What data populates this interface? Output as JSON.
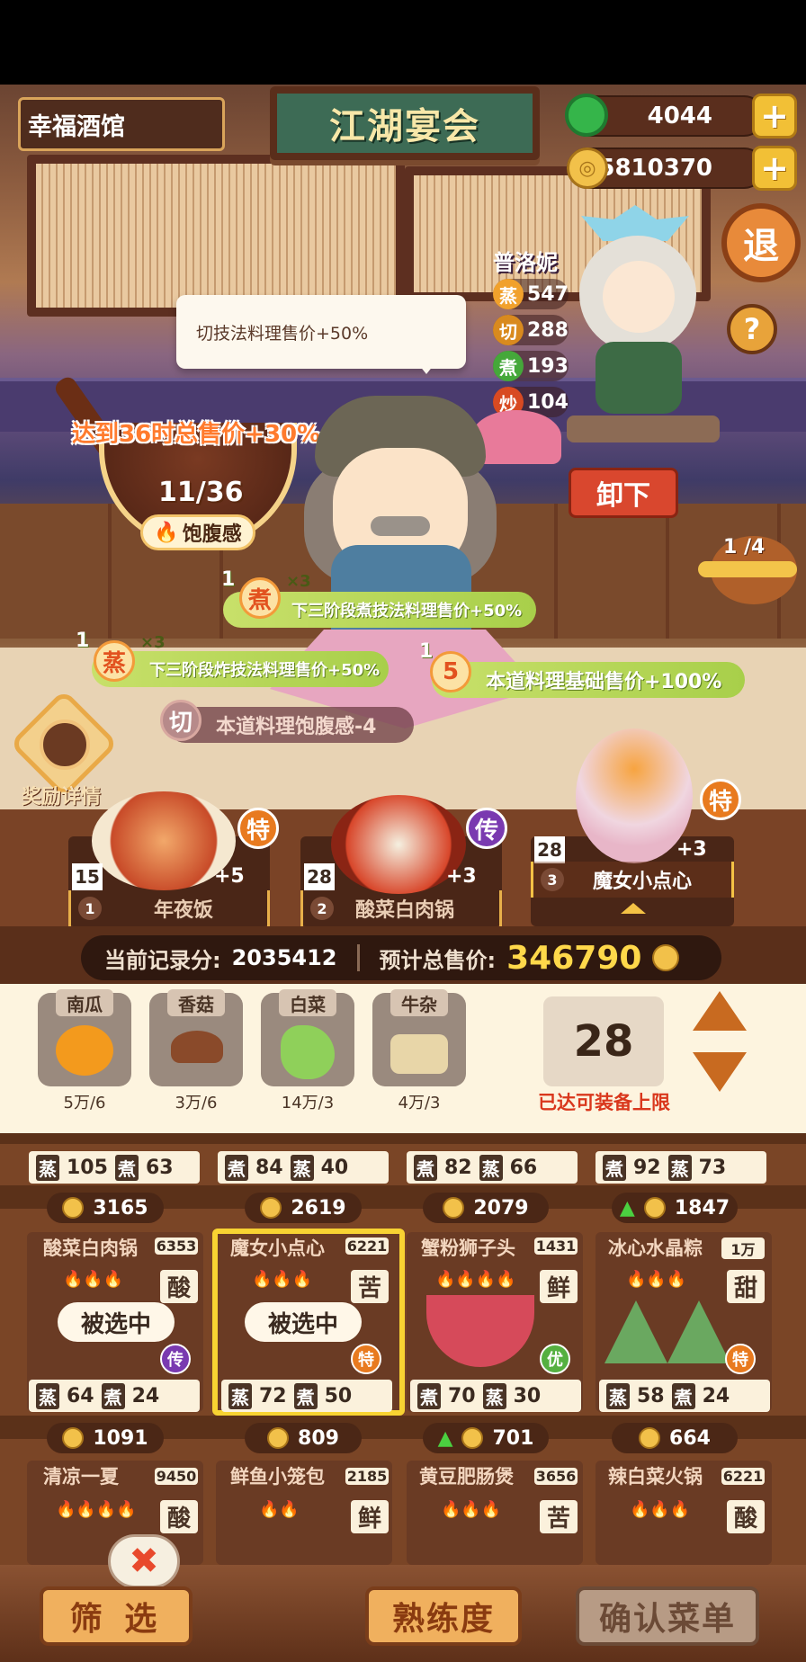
{
  "header": {
    "shop_name": "幸福酒馆",
    "title_sign": "江湖宴会",
    "jade": "4044",
    "coins": "5810370",
    "plus": "+",
    "exit": "退",
    "help": "?"
  },
  "chef": {
    "name": "普洛妮",
    "stats": [
      {
        "key": "蒸",
        "value": "547",
        "color": "#f1a12c"
      },
      {
        "key": "切",
        "value": "288",
        "color": "#d98a1e"
      },
      {
        "key": "煮",
        "value": "193",
        "color": "#45a83a"
      },
      {
        "key": "炒",
        "value": "104",
        "color": "#d84a22"
      }
    ],
    "unload": "卸下",
    "slot_progress": "1 /4"
  },
  "tooltip": "切技法料理售价+50%",
  "goal": {
    "text": "达到36时总售价+30%",
    "progress": "11/36",
    "label": "饱腹感"
  },
  "buffs": [
    {
      "num": "1",
      "icon": "煮",
      "times": "×3",
      "text": "下三阶段煮技法料理售价+50%"
    },
    {
      "num": "1",
      "icon": "蒸",
      "times": "×3",
      "text": "下三阶段炸技法料理售价+50%"
    },
    {
      "num": "1",
      "icon": "5",
      "times": "",
      "text": "本道料理基础售价+100%"
    },
    {
      "num": "",
      "icon": "切",
      "times": "",
      "text": "本道料理饱腹感-4"
    }
  ],
  "reward": "奖励详情",
  "selected_dishes": [
    {
      "idx": "1",
      "name": "年夜饭",
      "qty": "15",
      "bonus": "+5",
      "badge": "特"
    },
    {
      "idx": "2",
      "name": "酸菜白肉锅",
      "qty": "28",
      "bonus": "+3",
      "badge": "传"
    },
    {
      "idx": "3",
      "name": "魔女小点心",
      "qty": "28",
      "bonus": "+3",
      "badge": "特"
    }
  ],
  "score": {
    "record_label": "当前记录分:",
    "record_value": "2035412",
    "total_label": "预计总售价:",
    "total_value": "346790"
  },
  "ingredients": [
    {
      "name": "南瓜",
      "count": "5万/6",
      "color": "#f39a1d"
    },
    {
      "name": "香菇",
      "count": "3万/6",
      "color": "#8a4a2a"
    },
    {
      "name": "白菜",
      "count": "14万/3",
      "color": "#8fd05a"
    },
    {
      "name": "牛杂",
      "count": "4万/3",
      "color": "#e8d6a8"
    }
  ],
  "equip": {
    "count": "28",
    "limit_text": "已达可装备上限"
  },
  "grid_row0": [
    {
      "s1k": "蒸",
      "s1v": "105",
      "s2k": "煮",
      "s2v": "63",
      "price": "3165",
      "up": false
    },
    {
      "s1k": "煮",
      "s1v": "84",
      "s2k": "蒸",
      "s2v": "40",
      "price": "2619",
      "up": false
    },
    {
      "s1k": "煮",
      "s1v": "82",
      "s2k": "蒸",
      "s2v": "66",
      "price": "2079",
      "up": false
    },
    {
      "s1k": "煮",
      "s1v": "92",
      "s2k": "蒸",
      "s2v": "73",
      "price": "1847",
      "up": true
    }
  ],
  "grid_row1": [
    {
      "name": "酸菜白肉锅",
      "tag": "6353",
      "flavor": "酸",
      "fires": "🔥🔥🔥",
      "badge": "传",
      "selected": "被选中",
      "s1k": "蒸",
      "s1v": "64",
      "s2k": "煮",
      "s2v": "24",
      "price": "1091",
      "up": false
    },
    {
      "name": "魔女小点心",
      "tag": "6221",
      "flavor": "苦",
      "fires": "🔥🔥🔥",
      "badge": "特",
      "selected": "被选中",
      "s1k": "蒸",
      "s1v": "72",
      "s2k": "煮",
      "s2v": "50",
      "price": "809",
      "up": false
    },
    {
      "name": "蟹粉狮子头",
      "tag": "1431",
      "flavor": "鲜",
      "fires": "🔥🔥🔥🔥",
      "badge": "优",
      "selected": "",
      "s1k": "煮",
      "s1v": "70",
      "s2k": "蒸",
      "s2v": "30",
      "price": "701",
      "up": true
    },
    {
      "name": "冰心水晶粽",
      "tag": "1万",
      "flavor": "甜",
      "fires": "🔥🔥🔥",
      "badge": "特",
      "selected": "",
      "s1k": "蒸",
      "s1v": "58",
      "s2k": "煮",
      "s2v": "24",
      "price": "664",
      "up": false
    }
  ],
  "grid_row2": [
    {
      "name": "清凉一夏",
      "tag": "9450",
      "flavor": "酸",
      "fires": "🔥🔥🔥🔥"
    },
    {
      "name": "鲜鱼小笼包",
      "tag": "2185",
      "flavor": "鲜",
      "fires": "🔥🔥"
    },
    {
      "name": "黄豆肥肠煲",
      "tag": "3656",
      "flavor": "苦",
      "fires": "🔥🔥🔥"
    },
    {
      "name": "辣白菜火锅",
      "tag": "6221",
      "flavor": "酸",
      "fires": "🔥🔥🔥"
    }
  ],
  "bottom": {
    "filter": "筛 选",
    "proficiency": "熟练度",
    "confirm": "确认菜单",
    "close": "✖"
  }
}
